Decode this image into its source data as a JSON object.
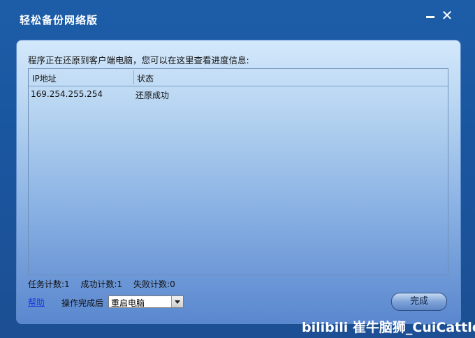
{
  "window": {
    "title": "轻松备份网络版"
  },
  "main": {
    "prompt": "程序正在还原到客户端电脑，您可以在这里查看进度信息:",
    "table": {
      "columns": [
        "IP地址",
        "状态"
      ],
      "rows": [
        {
          "ip": "169.254.255.254",
          "status": "还原成功"
        }
      ]
    },
    "counts": {
      "tasks": "任务计数:1",
      "success": "成功计数:1",
      "fail": "失败计数:0"
    },
    "help_link": "帮助",
    "after_label": "操作完成后",
    "after_select": {
      "value": "重启电脑"
    },
    "done_button": "完成"
  },
  "watermark": "bilibili 崔牛脑狮_CuiCattle"
}
